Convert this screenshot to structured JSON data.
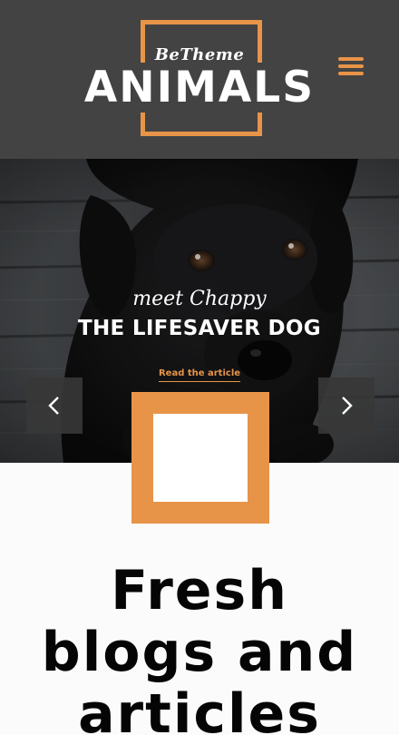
{
  "header": {
    "logo_small": "BeTheme",
    "logo_big": "ANIMALS",
    "menu_icon": "hamburger-menu-icon",
    "accent_color": "#e79449",
    "background_color": "#434343"
  },
  "hero": {
    "eyebrow": "meet Chappy",
    "title": "THE LIFESAVER DOG",
    "link_label": "Read the article",
    "prev_icon": "chevron-left-icon",
    "next_icon": "chevron-right-icon"
  },
  "section": {
    "heading_lines": [
      "Fresh",
      "blogs and",
      "articles"
    ]
  }
}
